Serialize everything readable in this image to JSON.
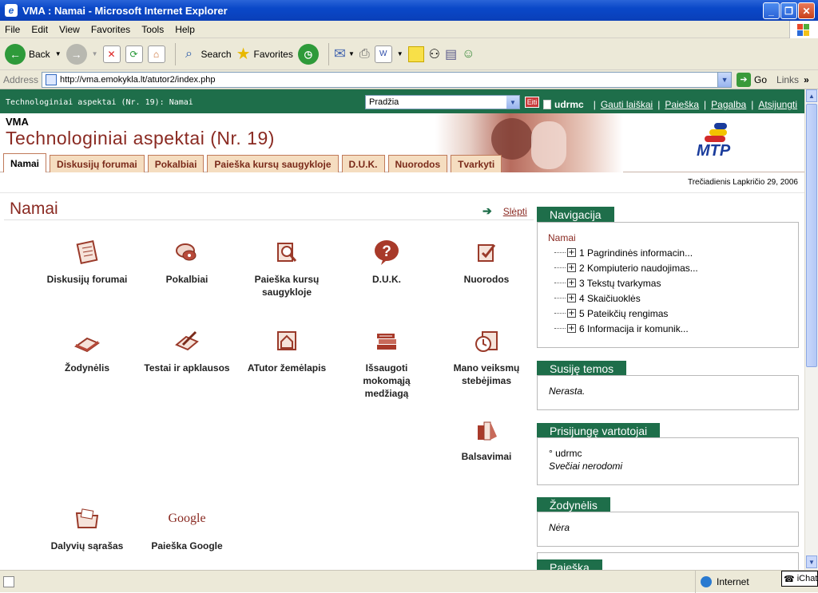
{
  "browser": {
    "title": "VMA : Namai - Microsoft Internet Explorer",
    "menu": [
      "File",
      "Edit",
      "View",
      "Favorites",
      "Tools",
      "Help"
    ],
    "toolbar": {
      "back": "Back",
      "search": "Search",
      "favorites": "Favorites"
    },
    "address_label": "Address",
    "url": "http://vma.emokykla.lt/atutor2/index.php",
    "go_label": "Go",
    "links_label": "Links",
    "status_zone": "Internet",
    "ichat": "iChat"
  },
  "site": {
    "breadcrumb": "Technologiniai aspektai (Nr. 19): Namai",
    "jump_select": "Pradžia",
    "jump_button": "Eiti",
    "username": "udrmc",
    "user_links": [
      "Gauti laiškai",
      "Paieška",
      "Pagalba",
      "Atsijungti"
    ],
    "site_name": "VMA",
    "course_title": "Technologiniai aspektai (Nr. 19)",
    "logo_text": "MTP",
    "tabs": [
      "Namai",
      "Diskusijų forumai",
      "Pokalbiai",
      "Paieška kursų saugykloje",
      "D.U.K.",
      "Nuorodos",
      "Tvarkyti"
    ],
    "date": "Trečiadienis Lapkričio 29, 2006",
    "page_title": "Namai",
    "hide_link": "Slėpti"
  },
  "modules": [
    {
      "label": "Diskusijų forumai",
      "icon": "forum-icon"
    },
    {
      "label": "Pokalbiai",
      "icon": "chat-icon"
    },
    {
      "label": "Paieška kursų saugykloje",
      "icon": "search-book-icon"
    },
    {
      "label": "D.U.K.",
      "icon": "question-icon"
    },
    {
      "label": "Nuorodos",
      "icon": "links-icon"
    },
    {
      "label": "Žodynėlis",
      "icon": "glossary-icon"
    },
    {
      "label": "Testai ir apklausos",
      "icon": "tests-icon"
    },
    {
      "label": "ATutor žemėlapis",
      "icon": "sitemap-icon"
    },
    {
      "label": "Išsaugoti mokomąją medžiagą",
      "icon": "books-icon"
    },
    {
      "label": "Mano veiksmų stebėjimas",
      "icon": "clock-icon"
    },
    {
      "label": "Balsavimai",
      "icon": "poll-icon"
    },
    {
      "label": "Dalyvių sąrašas",
      "icon": "folder-icon"
    },
    {
      "label": "Paieška Google",
      "icon": "google-icon"
    }
  ],
  "google_logo_text": "Google",
  "sidebar": {
    "navigation": {
      "title": "Navigacija",
      "root": "Namai",
      "items": [
        "1 Pagrindinės informacin...",
        "2 Kompiuterio naudojimas...",
        "3 Tekstų tvarkymas",
        "4 Skaičiuoklės",
        "5 Pateikčių rengimas",
        "6 Informacija ir komunik..."
      ]
    },
    "related": {
      "title": "Susiję temos",
      "text": "Nerasta."
    },
    "online": {
      "title": "Prisijungę vartotojai",
      "user": "° udrmc",
      "note": "Svečiai nerodomi"
    },
    "glossary": {
      "title": "Žodynėlis",
      "text": "Nėra"
    },
    "search": {
      "title": "Paieška"
    }
  }
}
